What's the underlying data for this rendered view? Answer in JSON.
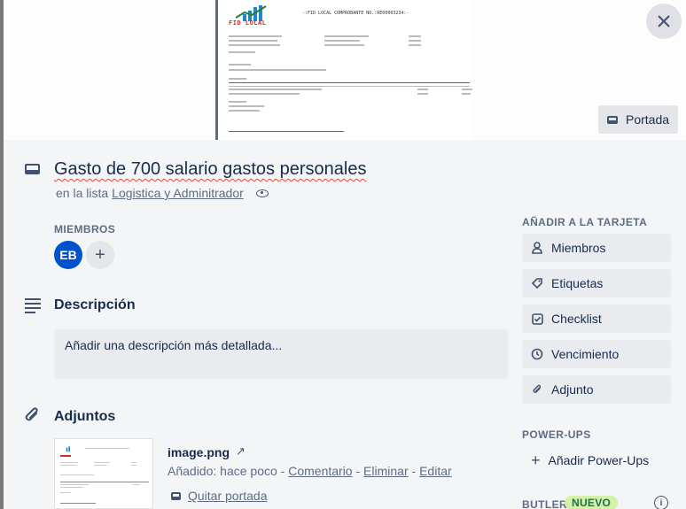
{
  "card": {
    "title": "Gasto de 700 salario gastos personales",
    "in_list_prefix": "en la lista",
    "list_name": "Logistica y Adminitrador"
  },
  "cover": {
    "portada_label": "Portada",
    "doc_logo_text": "FID LOCAL",
    "doc_header": "-:FID LOCAL COMPROBANTE NO.:RE00003234:-"
  },
  "members": {
    "label": "MIEMBROS",
    "avatar_initials": "EB"
  },
  "description": {
    "title": "Descripción",
    "placeholder": "Añadir una descripción más detallada..."
  },
  "attachments": {
    "title": "Adjuntos",
    "file_name": "image.png",
    "added_text": "Añadido: hace poco",
    "comment_link": "Comentario",
    "delete_link": "Eliminar",
    "edit_link": "Editar",
    "remove_cover": "Quitar portada"
  },
  "sidebar": {
    "add_to_card_label": "AÑADIR A LA TARJETA",
    "buttons": [
      {
        "label": "Miembros",
        "icon": "person-icon"
      },
      {
        "label": "Etiquetas",
        "icon": "tag-icon"
      },
      {
        "label": "Checklist",
        "icon": "checkbox-icon"
      },
      {
        "label": "Vencimiento",
        "icon": "clock-icon"
      },
      {
        "label": "Adjunto",
        "icon": "paperclip-icon"
      }
    ],
    "powerups_label": "POWER-UPS",
    "add_powerups": "Añadir Power-Ups",
    "butler_label": "BUTLER",
    "new_badge": "NUEVO"
  },
  "colors": {
    "background": "#f4f5f7",
    "avatar": "#0052cc",
    "badge": "#d3f1a7"
  }
}
